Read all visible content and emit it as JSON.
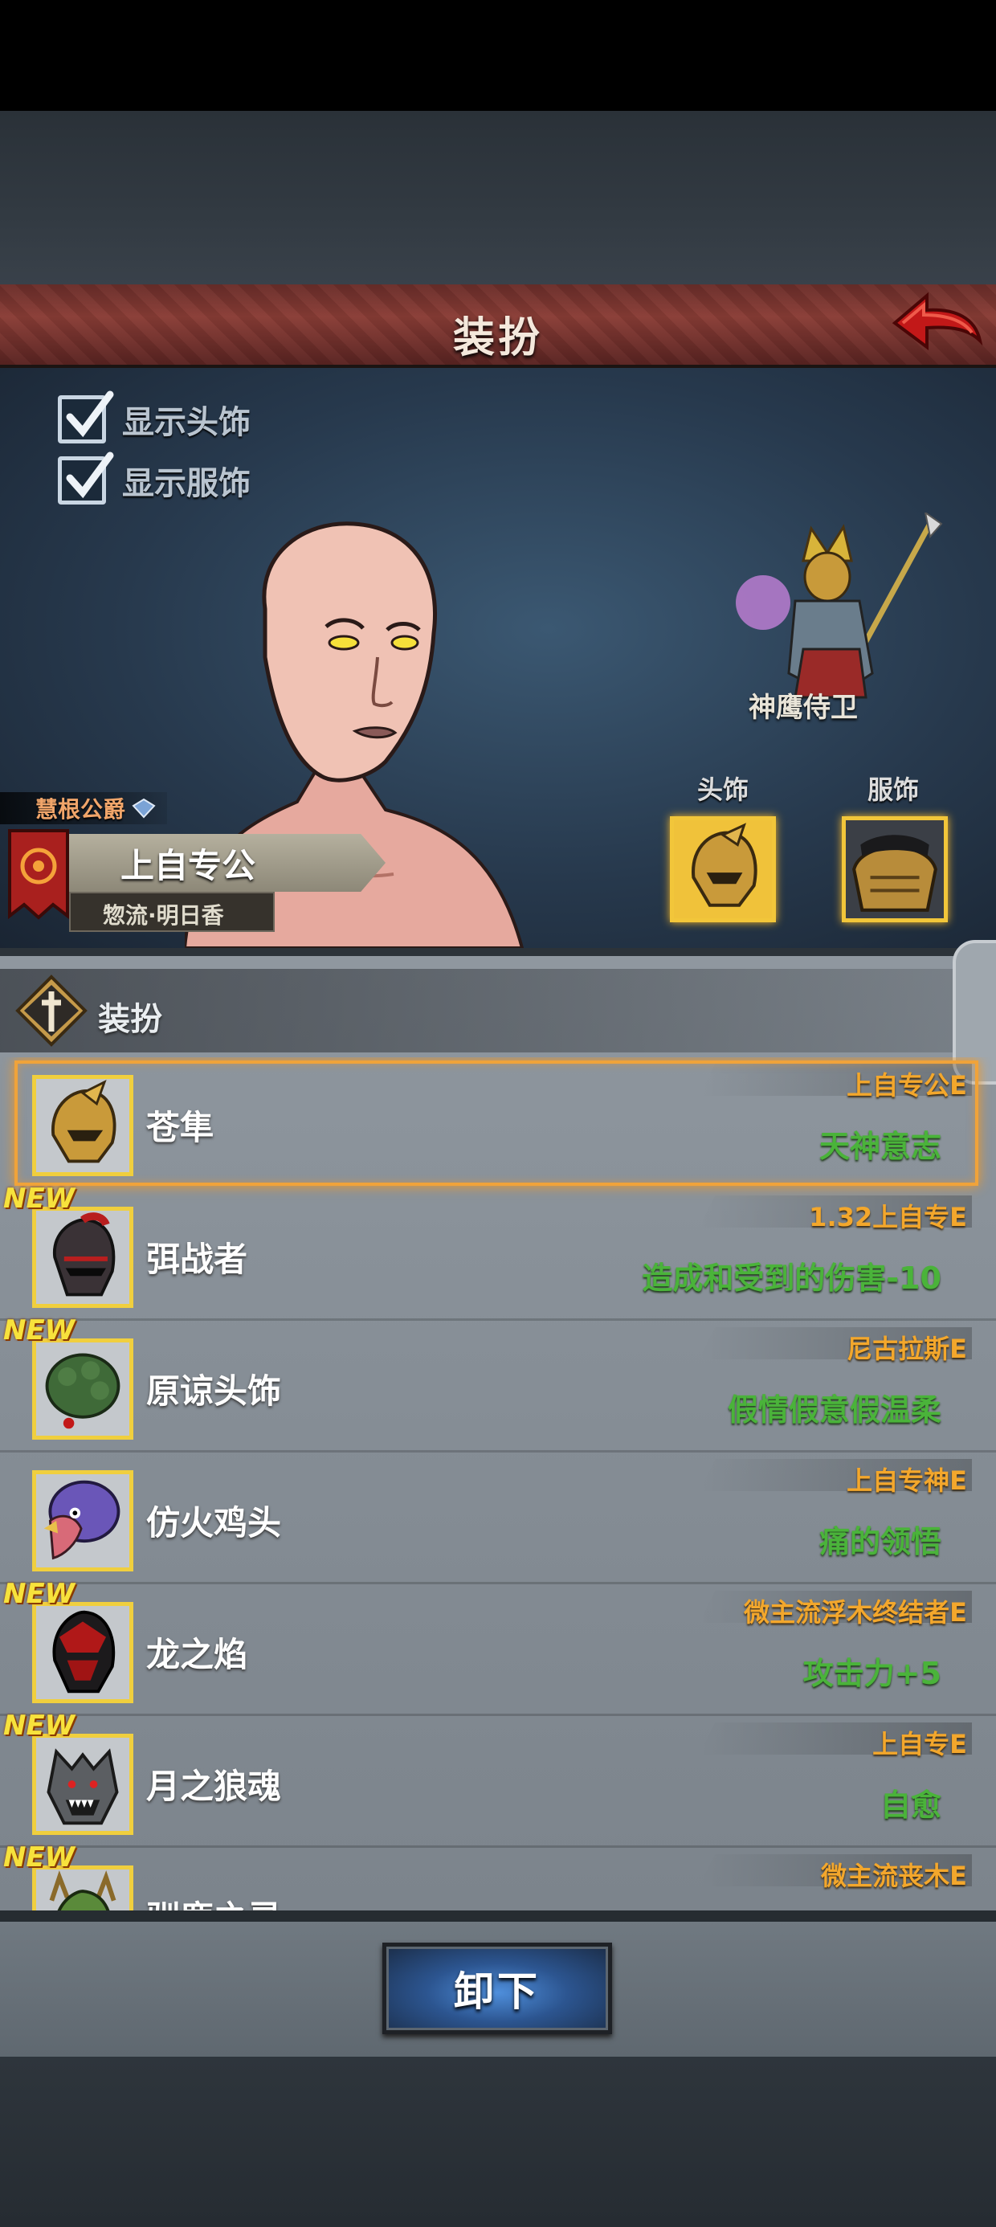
{
  "header": {
    "title": "装扮"
  },
  "toggles": [
    {
      "label": "显示头饰",
      "checked": true
    },
    {
      "label": "显示服饰",
      "checked": true
    }
  ],
  "npc": {
    "name": "神鹰侍卫"
  },
  "slots": {
    "head_label": "头饰",
    "outfit_label": "服饰"
  },
  "character": {
    "title": "慧根公爵",
    "name": "上自专公",
    "subtitle": "惣流·明日香"
  },
  "panel": {
    "header_label": "装扮"
  },
  "items": [
    {
      "name": "苍隼",
      "owner": "上自专公E",
      "effect": "天神意志",
      "is_new": false,
      "selected": true,
      "icon": "golden-hawk-helmet-icon"
    },
    {
      "name": "弭战者",
      "owner": "1.32上自专E",
      "effect": "造成和受到的伤害-10",
      "is_new": true,
      "selected": false,
      "icon": "dark-knight-helmet-icon"
    },
    {
      "name": "原谅头饰",
      "owner": "尼古拉斯E",
      "effect": "假情假意假温柔",
      "is_new": true,
      "selected": false,
      "icon": "green-hat-icon"
    },
    {
      "name": "仿火鸡头",
      "owner": "上自专神E",
      "effect": "痛的领悟",
      "is_new": false,
      "selected": false,
      "icon": "turkey-head-icon"
    },
    {
      "name": "龙之焰",
      "owner": "微主流浮木终结者E",
      "effect": "攻击力+5",
      "is_new": true,
      "selected": false,
      "icon": "red-dragon-helmet-icon"
    },
    {
      "name": "月之狼魂",
      "owner": "上自专E",
      "effect": "自愈",
      "is_new": true,
      "selected": false,
      "icon": "wolf-helmet-icon"
    },
    {
      "name": "驯鹿之灵",
      "owner": "微主流丧木E",
      "effect": "",
      "is_new": true,
      "selected": false,
      "icon": "deer-helmet-icon"
    }
  ],
  "new_badge": "NEW",
  "footer": {
    "unload_label": "卸下"
  }
}
